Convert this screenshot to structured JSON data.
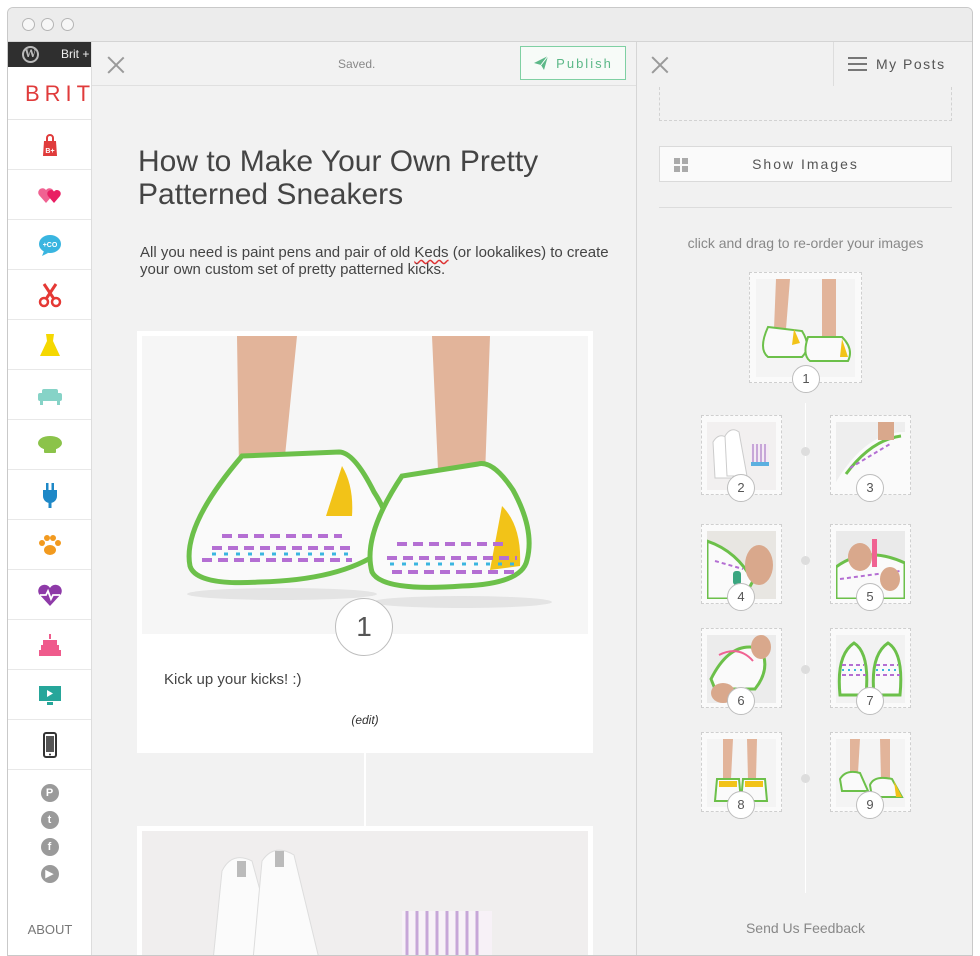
{
  "rail": {
    "top_link": "Brit +",
    "brand": "BRIT",
    "about": "ABOUT",
    "categories": [
      "shop-bag-icon",
      "hearts-icon",
      "chat-bubble-icon",
      "scissors-icon",
      "dress-icon",
      "sofa-icon",
      "chef-hat-icon",
      "plug-icon",
      "paw-icon",
      "heartbeat-icon",
      "cake-icon",
      "monitor-icon",
      "phone-icon"
    ],
    "social": [
      "pinterest-icon",
      "twitter-icon",
      "facebook-icon",
      "youtube-icon"
    ]
  },
  "editor": {
    "status": "Saved.",
    "publish_label": "Publish",
    "title": "How to Make Your Own Pretty Patterned Sneakers",
    "intro_before": "All you need is paint pens and pair of old ",
    "intro_keds": "Keds",
    "intro_after": " (or lookalikes) to create your own custom set of pretty patterned kicks.",
    "step": {
      "number": "1",
      "text": "Kick up your kicks! :)",
      "edit_label": "(edit)"
    }
  },
  "panel": {
    "my_posts_label": "My Posts",
    "show_images_label": "Show Images",
    "hint": "click and drag to re-order your images",
    "thumb_numbers": [
      "1",
      "2",
      "3",
      "4",
      "5",
      "6",
      "7",
      "8",
      "9"
    ],
    "feedback": "Send Us Feedback"
  },
  "colors": {
    "brand": "#e03b3b",
    "publish_accent": "#5cb888",
    "sneaker_green": "#6cc04a",
    "sneaker_yellow": "#f2c318"
  }
}
